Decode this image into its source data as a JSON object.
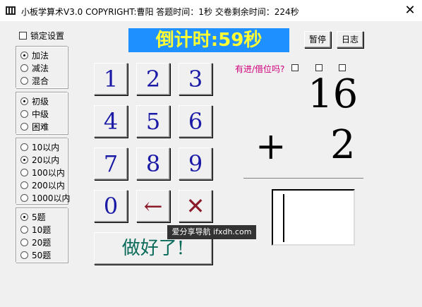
{
  "window": {
    "title": "小板学算术V3.0 COPYRIGHT:曹阳   答题时间：1秒  交卷剩余时间：224秒",
    "close_glyph": "✕"
  },
  "lock_setting": {
    "label": "锁定设置",
    "checked": false
  },
  "operation_group": {
    "options": [
      "加法",
      "减法",
      "混合"
    ],
    "selected": "加法"
  },
  "level_group": {
    "options": [
      "初级",
      "中级",
      "困难"
    ],
    "selected": "初级"
  },
  "range_group": {
    "options": [
      "10以内",
      "20以内",
      "100以内",
      "200以内",
      "1000以内"
    ],
    "selected": "20以内"
  },
  "count_group": {
    "options": [
      "5题",
      "10题",
      "20题",
      "50题"
    ],
    "selected": "5题"
  },
  "countdown": {
    "text": "倒计时:59秒",
    "bg_color": "#1e90ff",
    "text_color": "#ffff33"
  },
  "toolbar": {
    "pause_label": "暂停",
    "log_label": "日志"
  },
  "keypad": {
    "keys": [
      "1",
      "2",
      "3",
      "4",
      "5",
      "6",
      "7",
      "8",
      "9",
      "0",
      "←",
      "✕"
    ]
  },
  "done_button": {
    "label": "做好了!"
  },
  "carry": {
    "label": "有进/借位吗?",
    "boxes": [
      false,
      false,
      false
    ]
  },
  "problem": {
    "operand1": "16",
    "operator": "+",
    "operand2": "2"
  },
  "answer_field": {
    "value": ""
  },
  "watermark": {
    "text": "爱分享导航 ifxdh.com"
  }
}
